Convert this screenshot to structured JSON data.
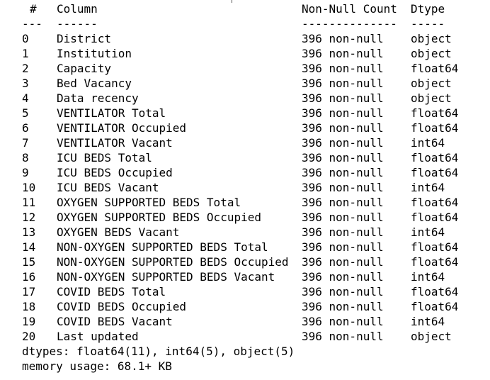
{
  "header": {
    "hash": "#",
    "column": "Column",
    "count": "Non-Null Count",
    "dtype": "Dtype"
  },
  "separator": {
    "hash": "---",
    "column": "------",
    "count": "--------------",
    "dtype": "-----"
  },
  "rows": [
    {
      "idx": "0",
      "column": "District",
      "count": "396 non-null",
      "dtype": "object"
    },
    {
      "idx": "1",
      "column": "Institution",
      "count": "396 non-null",
      "dtype": "object"
    },
    {
      "idx": "2",
      "column": "Capacity",
      "count": "396 non-null",
      "dtype": "float64"
    },
    {
      "idx": "3",
      "column": "Bed Vacancy",
      "count": "396 non-null",
      "dtype": "object"
    },
    {
      "idx": "4",
      "column": "Data recency",
      "count": "396 non-null",
      "dtype": "object"
    },
    {
      "idx": "5",
      "column": "VENTILATOR Total",
      "count": "396 non-null",
      "dtype": "float64"
    },
    {
      "idx": "6",
      "column": "VENTILATOR Occupied",
      "count": "396 non-null",
      "dtype": "float64"
    },
    {
      "idx": "7",
      "column": "VENTILATOR Vacant",
      "count": "396 non-null",
      "dtype": "int64"
    },
    {
      "idx": "8",
      "column": "ICU BEDS Total",
      "count": "396 non-null",
      "dtype": "float64"
    },
    {
      "idx": "9",
      "column": "ICU BEDS Occupied",
      "count": "396 non-null",
      "dtype": "float64"
    },
    {
      "idx": "10",
      "column": "ICU BEDS Vacant",
      "count": "396 non-null",
      "dtype": "int64"
    },
    {
      "idx": "11",
      "column": "OXYGEN SUPPORTED BEDS Total",
      "count": "396 non-null",
      "dtype": "float64"
    },
    {
      "idx": "12",
      "column": "OXYGEN SUPPORTED BEDS Occupied",
      "count": "396 non-null",
      "dtype": "float64"
    },
    {
      "idx": "13",
      "column": "OXYGEN BEDS Vacant",
      "count": "396 non-null",
      "dtype": "int64"
    },
    {
      "idx": "14",
      "column": "NON-OXYGEN SUPPORTED BEDS Total",
      "count": "396 non-null",
      "dtype": "float64"
    },
    {
      "idx": "15",
      "column": "NON-OXYGEN SUPPORTED BEDS Occupied",
      "count": "396 non-null",
      "dtype": "float64"
    },
    {
      "idx": "16",
      "column": "NON-OXYGEN SUPPORTED BEDS Vacant",
      "count": "396 non-null",
      "dtype": "int64"
    },
    {
      "idx": "17",
      "column": "COVID BEDS Total",
      "count": "396 non-null",
      "dtype": "float64"
    },
    {
      "idx": "18",
      "column": "COVID BEDS Occupied",
      "count": "396 non-null",
      "dtype": "float64"
    },
    {
      "idx": "19",
      "column": "COVID BEDS Vacant",
      "count": "396 non-null",
      "dtype": "int64"
    },
    {
      "idx": "20",
      "column": "Last updated",
      "count": "396 non-null",
      "dtype": "object"
    }
  ],
  "summary": {
    "dtypes": "dtypes: float64(11), int64(5), object(5)",
    "memory": "memory usage: 68.1+ KB"
  }
}
